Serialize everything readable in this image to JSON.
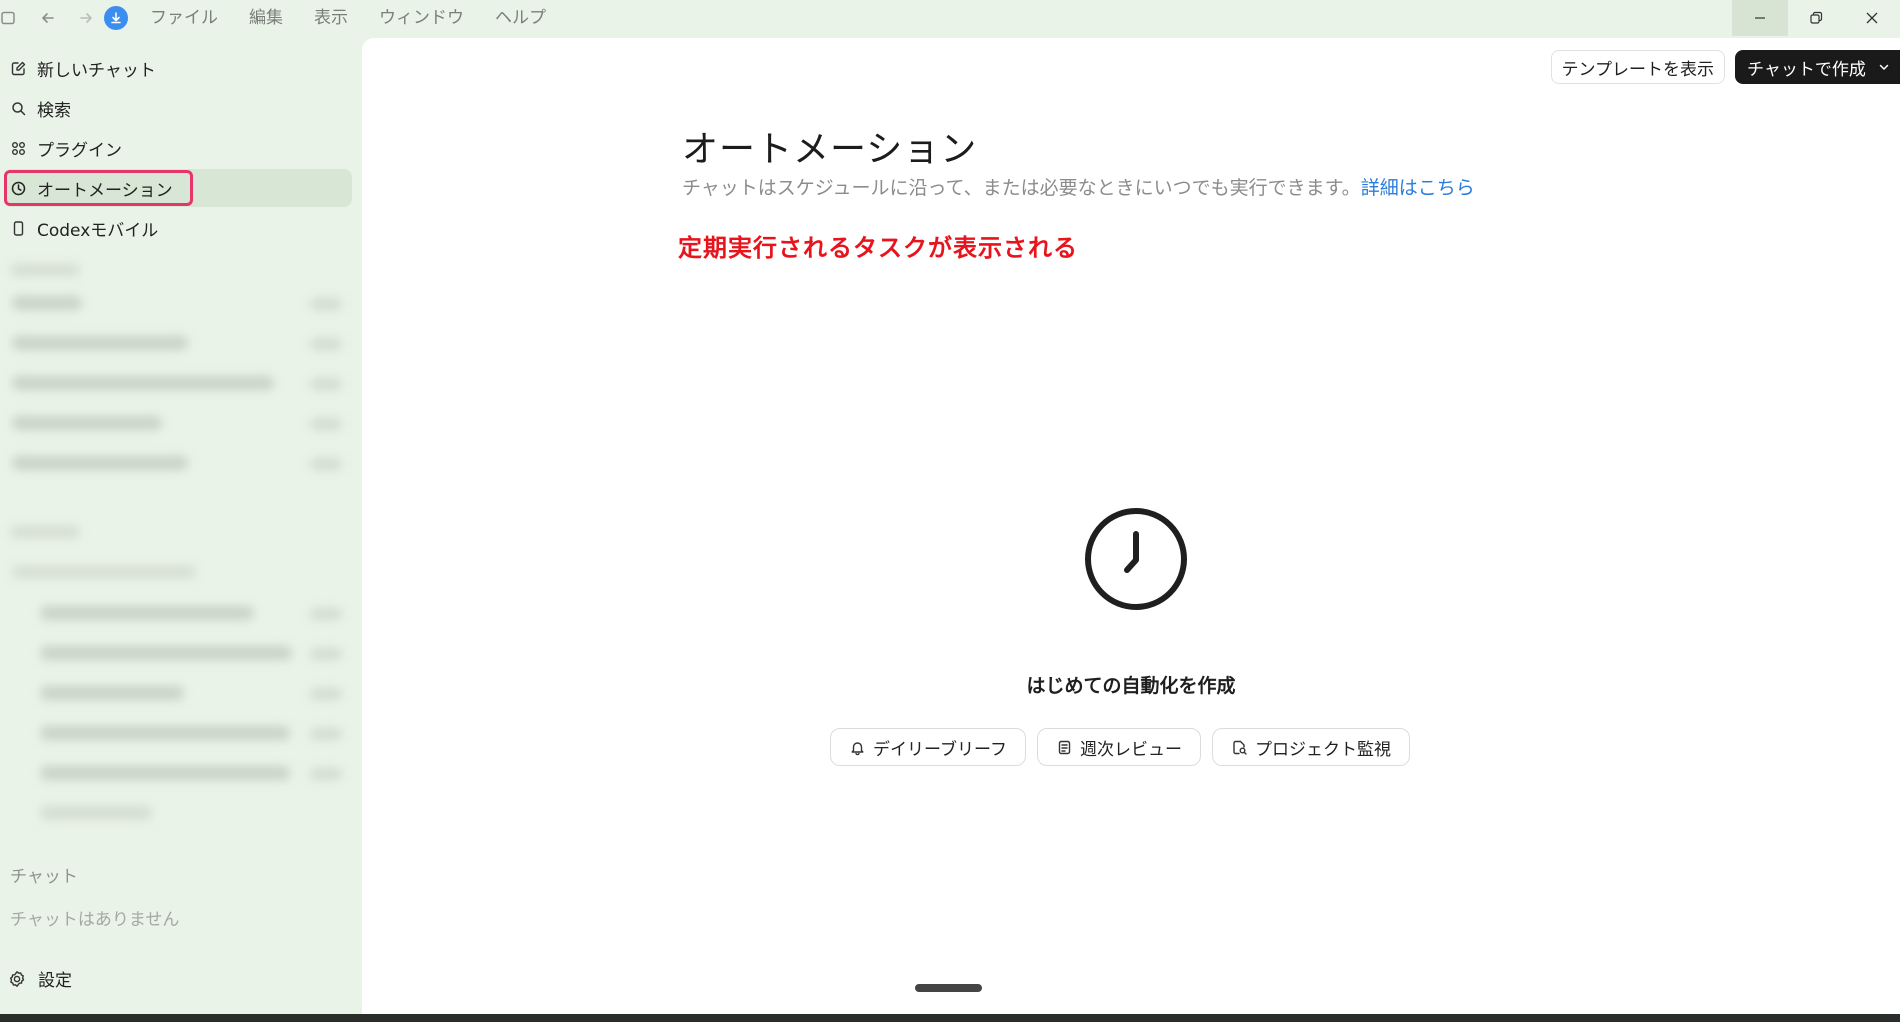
{
  "titlebar": {
    "menu": [
      "ファイル",
      "編集",
      "表示",
      "ウィンドウ",
      "ヘルプ"
    ],
    "icons": [
      "sidebar-toggle-icon",
      "back-arrow-icon",
      "forward-arrow-icon",
      "download-icon"
    ],
    "window_controls": [
      "minimize-icon",
      "restore-icon",
      "close-icon"
    ]
  },
  "sidebar": {
    "nav": [
      {
        "label": "新しいチャット",
        "icon": "compose-icon"
      },
      {
        "label": "検索",
        "icon": "search-icon"
      },
      {
        "label": "プラグイン",
        "icon": "grid-icon"
      },
      {
        "label": "オートメーション",
        "icon": "clock-icon",
        "selected": true
      },
      {
        "label": "Codexモバイル",
        "icon": "phone-icon"
      }
    ],
    "chats_heading": "チャット",
    "chats_empty": "チャットはありません",
    "settings_label": "設定"
  },
  "main": {
    "template_button": "テンプレートを表示",
    "create_button": "チャットで作成",
    "title": "オートメーション",
    "subtitle": "チャットはスケジュールに沿って、または必要なときにいつでも実行できます。",
    "learn_more": "詳細はこちら",
    "annotation": "定期実行されるタスクが表示される",
    "empty_title": "はじめての自動化を作成",
    "chips": [
      {
        "label": "デイリーブリーフ",
        "icon": "bell-icon"
      },
      {
        "label": "週次レビュー",
        "icon": "note-icon"
      },
      {
        "label": "プロジェクト監視",
        "icon": "file-search-icon"
      }
    ]
  },
  "colors": {
    "sidebar_bg": "#e9f3e7",
    "selected_bg": "#d8e6d5",
    "highlight_border": "#e5356b",
    "link": "#2b7ddc",
    "annotation": "#e8141c",
    "primary_button": "#1a1a1a",
    "accent_download": "#3b8ef0"
  }
}
